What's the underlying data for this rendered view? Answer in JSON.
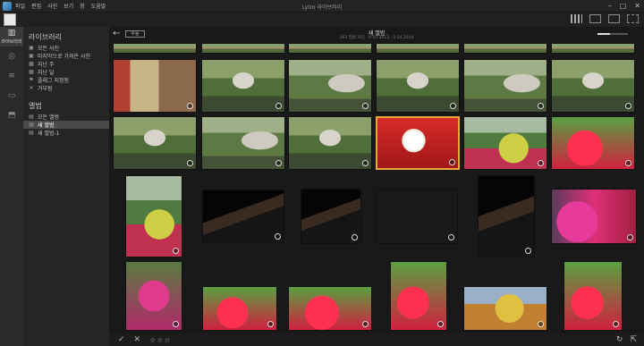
{
  "menubar": {
    "items": [
      "파일",
      "편집",
      "사진",
      "보기",
      "창",
      "도움말"
    ],
    "title": "Lytro 라이브러리"
  },
  "window_controls": [
    "–",
    "▢",
    "✕"
  ],
  "left_rail": [
    {
      "label": "라이브러리",
      "icon": "library-icon",
      "active": true
    },
    {
      "label": "",
      "icon": "edit-icon",
      "active": false
    },
    {
      "label": "",
      "icon": "adjust-icon",
      "active": false
    },
    {
      "label": "",
      "icon": "gallery-icon",
      "active": false
    },
    {
      "label": "",
      "icon": "share-icon",
      "active": false
    }
  ],
  "sidebar": {
    "library_title": "라이브러리",
    "library_items": [
      {
        "label": "모든 사진",
        "icon": "photos-icon"
      },
      {
        "label": "마지막으로 가져온 사진",
        "icon": "import-icon"
      },
      {
        "label": "지난 주",
        "icon": "calendar-icon"
      },
      {
        "label": "지난 달",
        "icon": "calendar-icon"
      },
      {
        "label": "플래그 지정됨",
        "icon": "flag-icon"
      },
      {
        "label": "거부됨",
        "icon": "reject-icon"
      }
    ],
    "album_title": "앨범",
    "album_items": [
      {
        "label": "모든 앨범",
        "icon": "album-icon",
        "selected": false
      },
      {
        "label": "새 앨범",
        "icon": "album-icon",
        "selected": true
      },
      {
        "label": "새 앨범-1",
        "icon": "album-icon",
        "selected": false
      }
    ]
  },
  "header": {
    "back": "←",
    "sort_label": "수동",
    "album_title": "새 앨범",
    "album_sub": "393 필름 사진  ·  9.10.2013  -  2.14.2014",
    "zoom_level": 0.4
  },
  "photos": [
    {
      "cls": "p-gate"
    },
    {
      "cls": "p-stone"
    },
    {
      "cls": "p-stone2"
    },
    {
      "cls": "p-stone"
    },
    {
      "cls": "p-stone2"
    },
    {
      "cls": "p-stone"
    },
    {
      "cls": "p-stone"
    },
    {
      "cls": "p-stone2"
    },
    {
      "cls": "p-stone"
    },
    {
      "cls": "p-flower",
      "selected": true
    },
    {
      "cls": "p-yellow"
    },
    {
      "cls": "p-red"
    },
    {
      "cls": "p-yellow"
    },
    {
      "cls": "p-dark"
    },
    {
      "cls": "p-dark"
    },
    {
      "cls": "p-dark2"
    },
    {
      "cls": "p-dark"
    },
    {
      "cls": "p-pink"
    },
    {
      "cls": "p-blur"
    },
    {
      "cls": "p-red"
    },
    {
      "cls": "p-red"
    },
    {
      "cls": "p-red"
    },
    {
      "cls": "p-tiger"
    },
    {
      "cls": "p-red"
    }
  ],
  "footer": {
    "check": "✓",
    "reject": "✕",
    "stars": "☆☆☆",
    "rotate": "↻",
    "export": "⇱"
  }
}
